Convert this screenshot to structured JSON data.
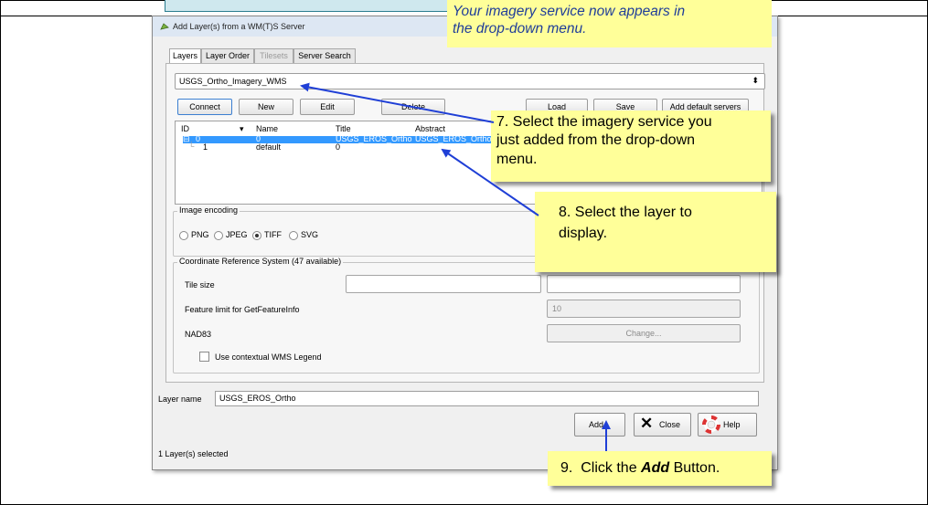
{
  "dialog": {
    "title": "Add Layer(s) from a WM(T)S Server",
    "tabs": [
      {
        "label": "Layers",
        "active": true
      },
      {
        "label": "Layer Order"
      },
      {
        "label": "Tilesets",
        "disabled": true
      },
      {
        "label": "Server Search"
      }
    ],
    "server_select": {
      "value": "USGS_Ortho_Imagery_WMS",
      "arrow": "⬍"
    },
    "buttons": {
      "connect": "Connect",
      "new": "New",
      "edit": "Edit",
      "delete": "Delete",
      "load": "Load",
      "save": "Save",
      "add_default": "Add default servers"
    },
    "table": {
      "headers": [
        "ID",
        "Name",
        "Title",
        "Abstract"
      ],
      "rows": [
        {
          "id": "0",
          "name": "0",
          "title": "USGS_EROS_Ortho",
          "abstract": "USGS_EROS_Ortho"
        },
        {
          "id": "1",
          "name": "default",
          "title": "0",
          "abstract": ""
        }
      ]
    },
    "image_encoding": {
      "label": "Image encoding",
      "options": [
        "PNG",
        "JPEG",
        "TIFF",
        "SVG"
      ],
      "selected": "TIFF"
    },
    "crs": {
      "group_label": "Coordinate Reference System (47 available)",
      "tile_size_label": "Tile size",
      "feature_limit_label": "Feature limit for GetFeatureInfo",
      "feature_limit_value": "10",
      "crs_name": "NAD83",
      "change_button": "Change...",
      "legend_checkbox": "Use contextual WMS Legend"
    },
    "layer_name": {
      "label": "Layer name",
      "value": "USGS_EROS_Ortho"
    },
    "footer": {
      "add": "Add",
      "close": "Close",
      "help": "Help",
      "status": "1 Layer(s) selected"
    }
  },
  "callouts": {
    "top_line1": "Your imagery service now appears in",
    "top_line2": "the drop-down menu.",
    "step7_line1": "7.  Select the imagery service you",
    "step7_line2": "just added from the drop-down",
    "step7_line3": "menu.",
    "step8_line1": "8. Select the layer to",
    "step8_line2": "display.",
    "step9_prefix": "9.  Click the ",
    "step9_bold": "Add",
    "step9_suffix": " Button."
  },
  "colors": {
    "callout_bg": "#ffff99",
    "arrow": "#1f3fd6",
    "selection": "#3399ff"
  }
}
